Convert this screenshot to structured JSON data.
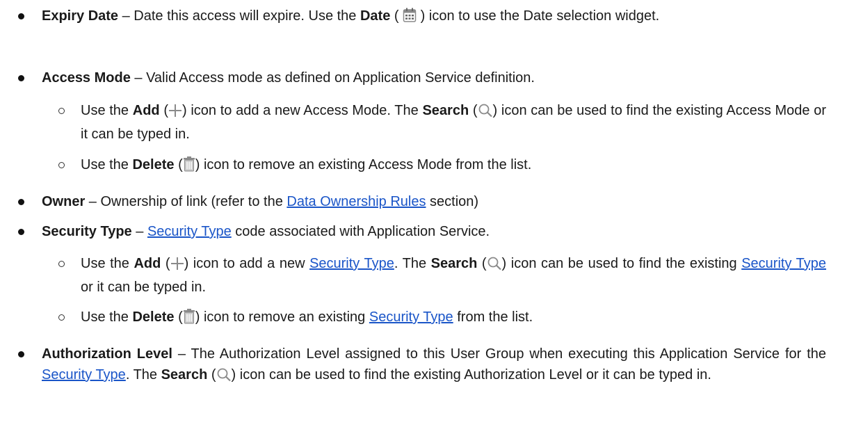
{
  "items": [
    {
      "type": "bullet",
      "term": "Expiry Date",
      "t1": " – Date this access will expire. Use the ",
      "b1": "Date",
      "t2": " ( ",
      "t3": " ) icon to use the Date selection widget."
    },
    {
      "type": "bullet",
      "term": "Access Mode",
      "t1": " – Valid Access mode as defined on Application Service definition."
    },
    {
      "type": "sub",
      "t1": "Use the ",
      "b1": "Add",
      "t2": " (",
      "t3": ") icon to add a new Access Mode. The ",
      "b2": "Search",
      "t4": " (",
      "t5": ") icon can be used to find the existing Access Mode or it can be typed in."
    },
    {
      "type": "sub",
      "t1": "Use the ",
      "b1": "Delete",
      "t2": " (",
      "t3": ") icon to remove an existing Access Mode from the list."
    },
    {
      "type": "bullet",
      "term": "Owner",
      "t1": " – Ownership of link (refer to the ",
      "link1": "Data Ownership Rules",
      "t2": " section)"
    },
    {
      "type": "bullet",
      "term": "Security Type",
      "t1": " – ",
      "link1": "Security Type",
      "t2": " code associated with Application Service."
    },
    {
      "type": "sub",
      "t1": "Use the ",
      "b1": "Add",
      "t2": " (",
      "t3": ") icon to add a new ",
      "link1": "Security Type",
      "t4": ". The ",
      "b2": "Search",
      "t5": " (",
      "t6": ") icon can be used to find the existing ",
      "link2": "Security Type",
      "t7": " or it can be typed in."
    },
    {
      "type": "sub",
      "t1": "Use the ",
      "b1": "Delete",
      "t2": " (",
      "t3": ") icon to remove an existing ",
      "link1": "Security Type",
      "t4": " from the list."
    },
    {
      "type": "bullet",
      "term": "Authorization Level",
      "t1": " – The Authorization Level assigned to this User Group when executing this Application Service for the ",
      "link1": "Security Type",
      "t2": ". The ",
      "b1": "Search",
      "t3": " (",
      "t4": ") icon can be used to find the existing Authorization Level or it can be typed in."
    }
  ],
  "icons": {
    "date": "calendar-icon",
    "add": "plus-icon",
    "search": "magnifier-icon",
    "delete": "trash-icon"
  },
  "colors": {
    "link": "#1a55c8",
    "icon": "#9a9a9a"
  }
}
